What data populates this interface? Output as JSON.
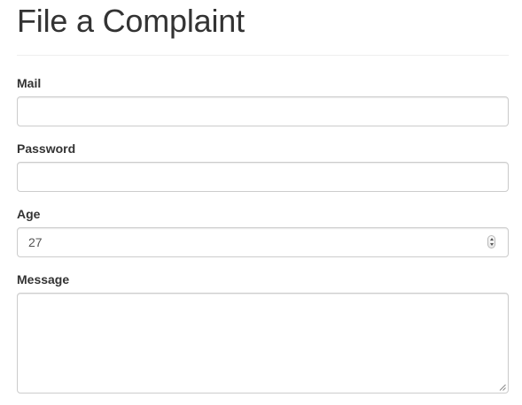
{
  "page": {
    "title": "File a Complaint"
  },
  "form": {
    "mail": {
      "label": "Mail",
      "value": ""
    },
    "password": {
      "label": "Password",
      "value": ""
    },
    "age": {
      "label": "Age",
      "value": "27"
    },
    "message": {
      "label": "Message",
      "value": ""
    }
  },
  "icons": {
    "age_spinner": "number-spinner-icon",
    "textarea_grip": "resize-grip-icon"
  }
}
